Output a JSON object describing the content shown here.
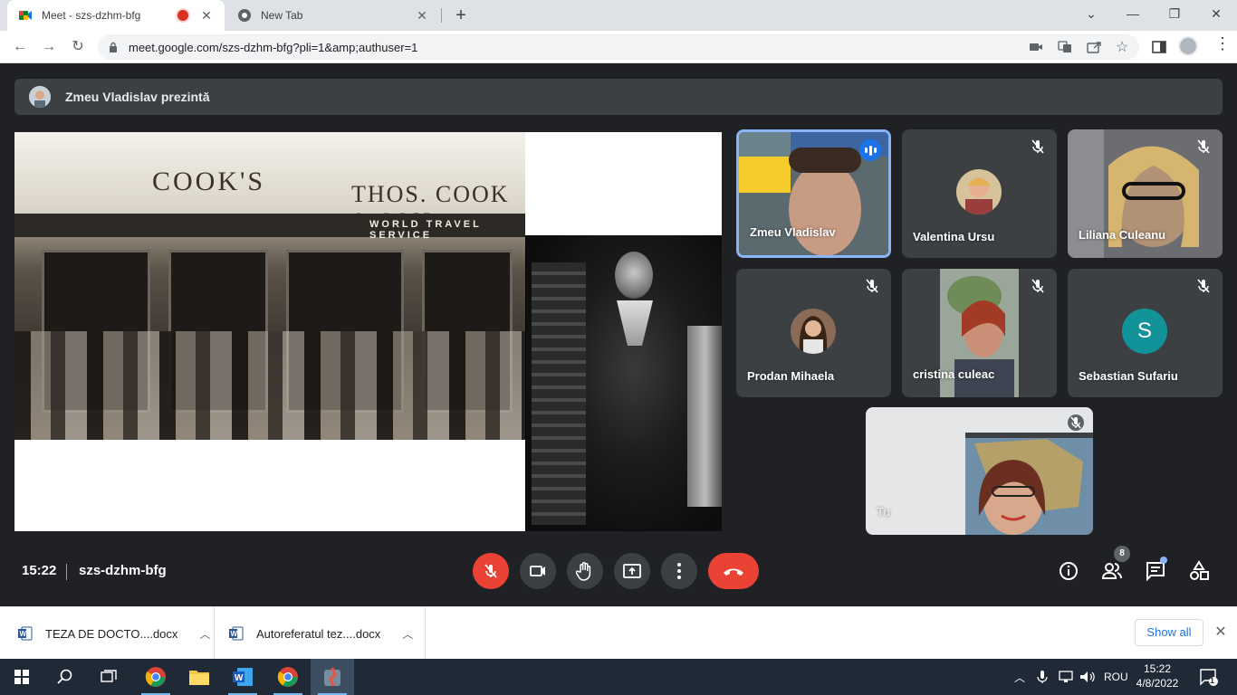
{
  "browser": {
    "tabs": [
      {
        "title": "Meet - szs-dzhm-bfg",
        "recording": true
      },
      {
        "title": "New Tab"
      }
    ],
    "url": "meet.google.com/szs-dzhm-bfg?pli=1&amp;authuser=1"
  },
  "meet": {
    "presenter_banner": "Zmeu Vladislav prezintă",
    "participants": [
      {
        "name": "Zmeu Vladislav",
        "speaking": true,
        "video": true
      },
      {
        "name": "Valentina Ursu",
        "muted": true,
        "video": false
      },
      {
        "name": "Liliana Culeanu",
        "muted": true,
        "video": true
      },
      {
        "name": "Prodan Mihaela",
        "muted": true,
        "video": false
      },
      {
        "name": "cristina culeac",
        "muted": true,
        "video": true
      },
      {
        "name": "Sebastian Sufariu",
        "muted": true,
        "video": false,
        "initial": "S",
        "color": "#12939a"
      },
      {
        "name": "Tu",
        "muted": true,
        "video": true
      }
    ],
    "slide": {
      "shop_sign": "COOK'S",
      "shop_sign_2": "THOS. COOK & SON",
      "shop_band": "WORLD TRAVEL SERVICE"
    },
    "controls": {
      "time": "15:22",
      "meeting_code": "szs-dzhm-bfg",
      "participant_count": "8",
      "accent_red": "#ea4335"
    }
  },
  "downloads": {
    "items": [
      "TEZA DE DOCTO....docx",
      "Autoreferatul tez....docx"
    ],
    "show_all": "Show all"
  },
  "taskbar": {
    "language": "ROU",
    "time": "15:22",
    "date": "4/8/2022",
    "notifications": "1"
  }
}
